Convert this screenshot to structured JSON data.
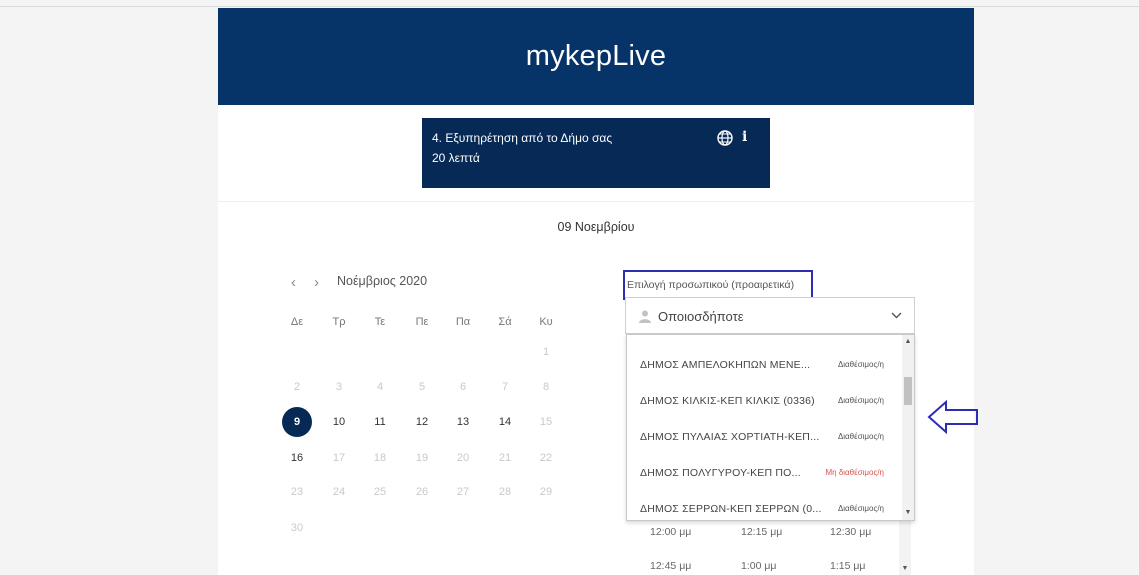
{
  "app": {
    "title": "mykepLive"
  },
  "service": {
    "title": "4. Εξυπηρέτηση από το Δήμο σας",
    "duration": "20 λεπτά",
    "globe_icon": "globe-icon",
    "info_icon": "info-icon",
    "info_label": "i"
  },
  "date_heading": "09 Νοεμβρίου",
  "calendar": {
    "prev_label": "‹",
    "next_label": "›",
    "month": "Νοέμβριος 2020",
    "weekdays": [
      "Δε",
      "Τρ",
      "Τε",
      "Πε",
      "Πα",
      "Σά",
      "Κυ"
    ],
    "days": [
      {
        "label": "1",
        "col": 6,
        "row": 0,
        "state": "disabled"
      },
      {
        "label": "2",
        "col": 0,
        "row": 1,
        "state": "disabled"
      },
      {
        "label": "3",
        "col": 1,
        "row": 1,
        "state": "disabled"
      },
      {
        "label": "4",
        "col": 2,
        "row": 1,
        "state": "disabled"
      },
      {
        "label": "5",
        "col": 3,
        "row": 1,
        "state": "disabled"
      },
      {
        "label": "6",
        "col": 4,
        "row": 1,
        "state": "disabled"
      },
      {
        "label": "7",
        "col": 5,
        "row": 1,
        "state": "disabled"
      },
      {
        "label": "8",
        "col": 6,
        "row": 1,
        "state": "disabled"
      },
      {
        "label": "9",
        "col": 0,
        "row": 2,
        "state": "selected"
      },
      {
        "label": "10",
        "col": 1,
        "row": 2,
        "state": "available"
      },
      {
        "label": "11",
        "col": 2,
        "row": 2,
        "state": "available"
      },
      {
        "label": "12",
        "col": 3,
        "row": 2,
        "state": "available"
      },
      {
        "label": "13",
        "col": 4,
        "row": 2,
        "state": "available"
      },
      {
        "label": "14",
        "col": 5,
        "row": 2,
        "state": "available"
      },
      {
        "label": "15",
        "col": 6,
        "row": 2,
        "state": "disabled"
      },
      {
        "label": "16",
        "col": 0,
        "row": 3,
        "state": "available"
      },
      {
        "label": "17",
        "col": 1,
        "row": 3,
        "state": "disabled"
      },
      {
        "label": "18",
        "col": 2,
        "row": 3,
        "state": "disabled"
      },
      {
        "label": "19",
        "col": 3,
        "row": 3,
        "state": "disabled"
      },
      {
        "label": "20",
        "col": 4,
        "row": 3,
        "state": "disabled"
      },
      {
        "label": "21",
        "col": 5,
        "row": 3,
        "state": "disabled"
      },
      {
        "label": "22",
        "col": 6,
        "row": 3,
        "state": "disabled"
      },
      {
        "label": "23",
        "col": 0,
        "row": 4,
        "state": "disabled"
      },
      {
        "label": "24",
        "col": 1,
        "row": 4,
        "state": "disabled"
      },
      {
        "label": "25",
        "col": 2,
        "row": 4,
        "state": "disabled"
      },
      {
        "label": "26",
        "col": 3,
        "row": 4,
        "state": "disabled"
      },
      {
        "label": "27",
        "col": 4,
        "row": 4,
        "state": "disabled"
      },
      {
        "label": "28",
        "col": 5,
        "row": 4,
        "state": "disabled"
      },
      {
        "label": "29",
        "col": 6,
        "row": 4,
        "state": "disabled"
      },
      {
        "label": "30",
        "col": 0,
        "row": 5,
        "state": "disabled"
      }
    ]
  },
  "staff": {
    "label": "Επιλογή προσωπικού (προαιρετικά)",
    "selected": "Οποιοσδήποτε",
    "person_icon": "person-icon",
    "options": [
      {
        "name": "ΔΗΜΟΣ ΑΜΠΕΛΟΚΗΠΩΝ ΜΕΝΕ...",
        "status": "Διαθέσιμος/η",
        "available": true
      },
      {
        "name": "ΔΗΜΟΣ ΚΙΛΚΙΣ-ΚΕΠ ΚΙΛΚΙΣ (0336)",
        "status": "Διαθέσιμος/η",
        "available": true
      },
      {
        "name": "ΔΗΜΟΣ ΠΥΛΑΙΑΣ ΧΟΡΤΙΑΤΗ-ΚΕΠ...",
        "status": "Διαθέσιμος/η",
        "available": true
      },
      {
        "name": "ΔΗΜΟΣ ΠΟΛΥΓΥΡΟΥ-ΚΕΠ ΠΟ...",
        "status": "Μη διαθέσιμος/η",
        "available": false
      },
      {
        "name": "ΔΗΜΟΣ ΣΕΡΡΩΝ-ΚΕΠ ΣΕΡΡΩΝ (0...",
        "status": "Διαθέσιμος/η",
        "available": true
      }
    ]
  },
  "times": [
    [
      "12:00 μμ",
      "12:15 μμ",
      "12:30 μμ"
    ],
    [
      "12:45 μμ",
      "1:00 μμ",
      "1:15 μμ"
    ]
  ],
  "colors": {
    "header": "#063469",
    "card": "#062a55",
    "highlight_box": "#2d2db4",
    "unavailable": "#d9534f"
  }
}
